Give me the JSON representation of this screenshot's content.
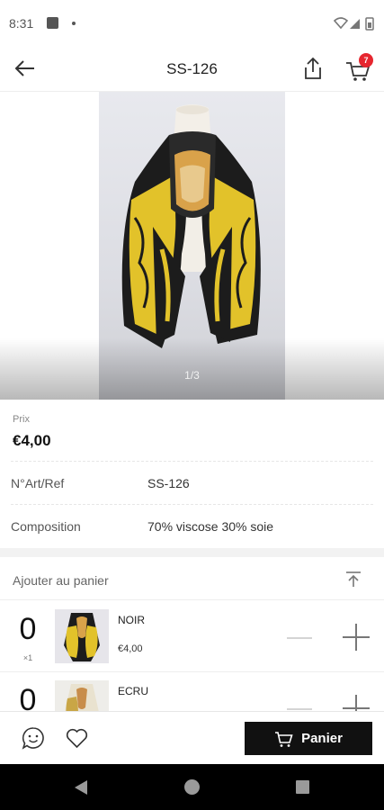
{
  "status_bar": {
    "time": "8:31"
  },
  "app_bar": {
    "title": "SS-126",
    "cart_count": "7"
  },
  "gallery": {
    "counter": "1/3"
  },
  "price": {
    "label": "Prix",
    "value": "€4,00"
  },
  "specs": [
    {
      "label": "N°Art/Ref",
      "value": "SS-126"
    },
    {
      "label": "Composition",
      "value": "70% viscose 30% soie"
    }
  ],
  "add_to_cart": {
    "title": "Ajouter au panier",
    "variants": [
      {
        "qty": "0",
        "min": "×1",
        "name": "NOIR",
        "price": "€4,00"
      },
      {
        "qty": "0",
        "min": "",
        "name": "ECRU",
        "price": ""
      }
    ]
  },
  "bottom_bar": {
    "cart_label": "Panier"
  },
  "colors": {
    "accent": "#111111",
    "badge": "#e6262f",
    "scarf_gold": "#e2c22a",
    "scarf_black": "#1c1c1c"
  }
}
